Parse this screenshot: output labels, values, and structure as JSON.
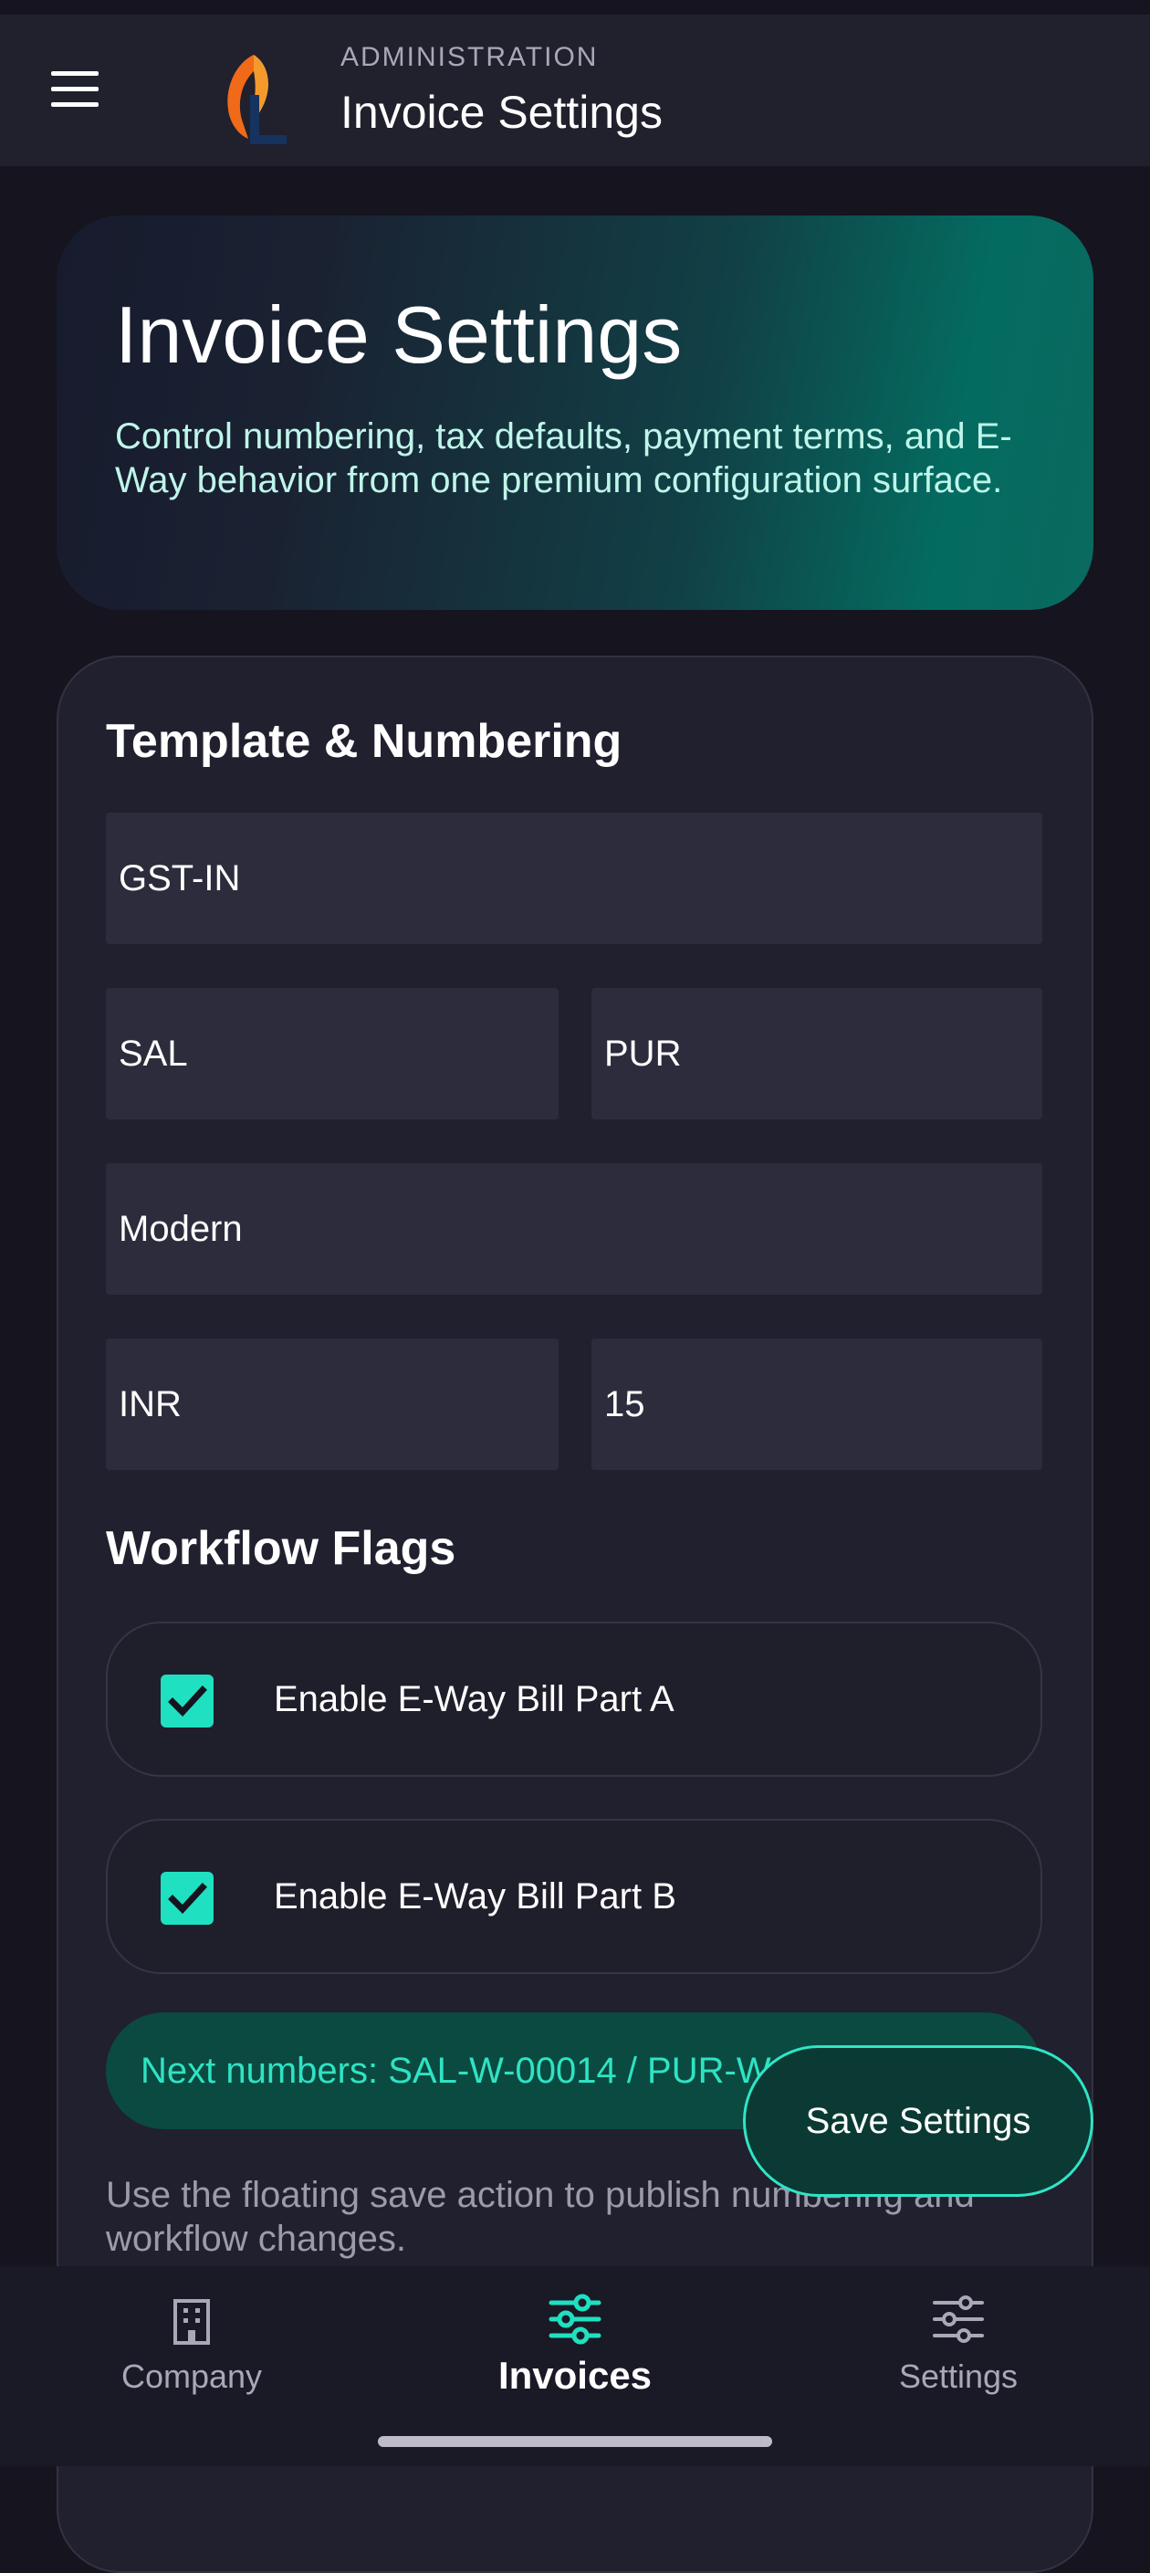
{
  "app_bar": {
    "eyebrow": "ADMINISTRATION",
    "title": "Invoice Settings"
  },
  "hero": {
    "title": "Invoice Settings",
    "description": "Control numbering, tax defaults, payment terms, and E-Way behavior from one premium configuration surface."
  },
  "template_section": {
    "title": "Template & Numbering",
    "fields": {
      "gst_template": "GST-IN",
      "sales_prefix": "SAL",
      "purchase_prefix": "PUR",
      "layout": "Modern",
      "currency": "INR",
      "payment_terms": "15"
    }
  },
  "workflow_section": {
    "title": "Workflow Flags",
    "flags": [
      {
        "label": "Enable E-Way Bill Part A",
        "checked": true
      },
      {
        "label": "Enable E-Way Bill Part B",
        "checked": true
      }
    ]
  },
  "next_numbers": "Next numbers: SAL-W-00014 / PUR-W-00014",
  "helper_text": "Use the floating save action to publish numbering and workflow changes.",
  "fab_label": "Save Settings",
  "bottom_nav": [
    {
      "label": "Company",
      "icon": "building-icon",
      "active": false
    },
    {
      "label": "Invoices",
      "icon": "sliders-icon",
      "active": true
    },
    {
      "label": "Settings",
      "icon": "sliders-icon",
      "active": false
    }
  ],
  "colors": {
    "accent": "#1fe0c0",
    "background": "#15141f",
    "surface": "#21202f"
  }
}
